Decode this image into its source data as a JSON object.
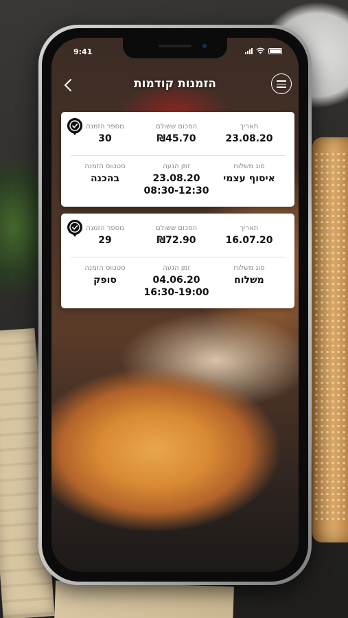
{
  "status_bar": {
    "time": "9:41"
  },
  "header": {
    "title": "הזמנות קודמות",
    "back_glyph": "‹"
  },
  "labels": {
    "date": "תאריך",
    "amount_paid": "הסכום ששולם",
    "order_number": "מספר הזמנה",
    "delivery_type": "סוג משלוח",
    "arrival_time": "זמן הגעה",
    "order_status": "סטטוס הזמנה"
  },
  "orders": [
    {
      "date": "23.08.20",
      "amount": "₪45.70",
      "order_number": "30",
      "delivery_type": "איסוף עצמי",
      "arrival_date": "23.08.20",
      "arrival_window": "08:30-12:30",
      "status": "בהכנה"
    },
    {
      "date": "16.07.20",
      "amount": "₪72.90",
      "order_number": "29",
      "delivery_type": "משלוח",
      "arrival_date": "04.06.20",
      "arrival_window": "16:30-19:00",
      "status": "סופק"
    }
  ],
  "icons": {
    "back": "chevron-left-icon",
    "menu": "hamburger-menu-icon",
    "order_marker": "check-pin-icon"
  }
}
